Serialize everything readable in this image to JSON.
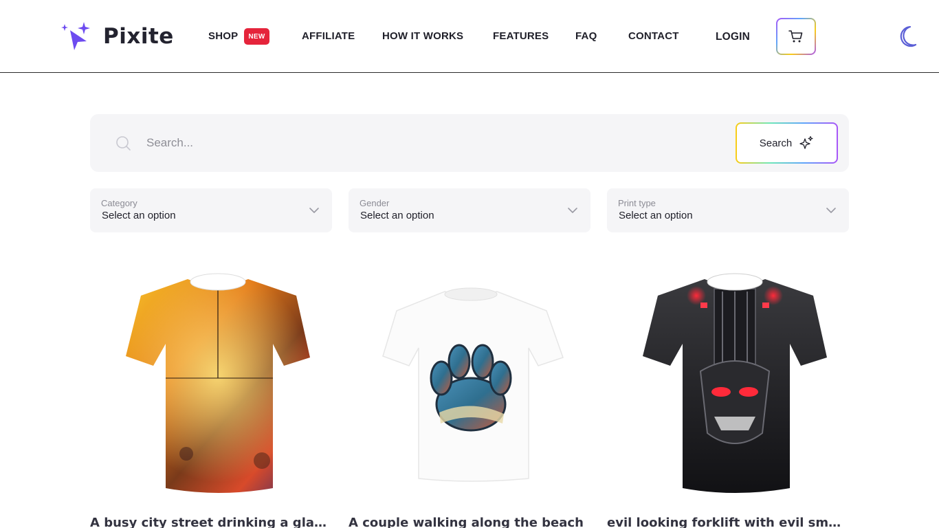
{
  "brand": {
    "name": "Pixite"
  },
  "nav": {
    "shop": "SHOP",
    "shop_badge": "NEW",
    "affiliate": "AFFILIATE",
    "how_it_works": "HOW IT WORKS",
    "features": "FEATURES",
    "faq": "FAQ",
    "contact": "CONTACT",
    "login": "LOGIN"
  },
  "icons": {
    "logo": "sparkle-cursor-icon",
    "cart": "cart-icon",
    "theme": "moon-icon",
    "search": "search-icon",
    "search_button": "sparkle-icon",
    "dropdown": "chevron-down-icon"
  },
  "colors": {
    "accent": "#6d4bf0",
    "badge": "#e5243b",
    "moon": "#5b5fd6"
  },
  "search": {
    "placeholder": "Search...",
    "value": "",
    "button_label": "Search"
  },
  "filters": [
    {
      "label": "Category",
      "value": "Select an option"
    },
    {
      "label": "Gender",
      "value": "Select an option"
    },
    {
      "label": "Print type",
      "value": "Select an option"
    }
  ],
  "products": [
    {
      "title": "A busy city street drinking a glass of wine with jazz music"
    },
    {
      "title": "A couple walking along the beach"
    },
    {
      "title": "evil looking forklift with evil smoke"
    }
  ]
}
